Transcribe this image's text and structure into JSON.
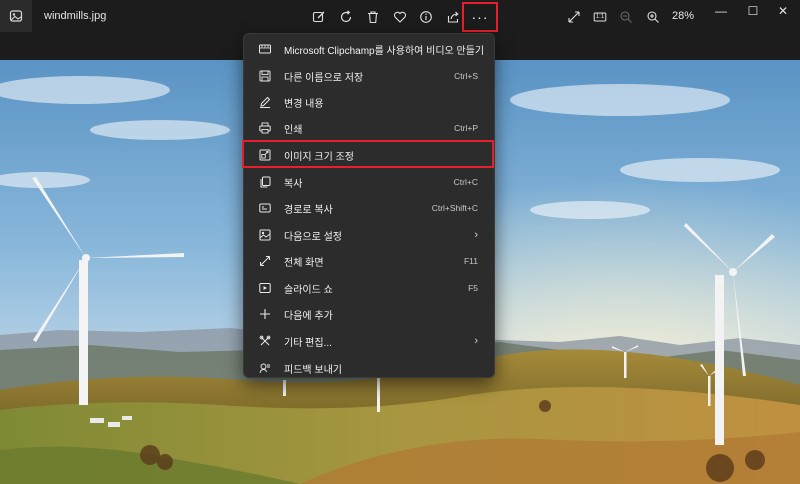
{
  "titlebar": {
    "filename": "windmills.jpg",
    "zoom": "28%",
    "more_label": "···",
    "actual_size_label": "1:1",
    "toolbar_icons": [
      "edit-icon",
      "rotate-icon",
      "delete-icon",
      "favorite-icon",
      "info-icon",
      "share-icon",
      "more-icon"
    ],
    "right_icons": [
      "fullscreen-icon",
      "actual-size-icon",
      "zoom-out-icon",
      "zoom-in-icon"
    ],
    "window_controls": {
      "minimize": "—",
      "maximize": "☐",
      "close": "✕"
    }
  },
  "menu": {
    "items": [
      {
        "label": "Microsoft Clipchamp를 사용하여 비디오 만들기",
        "shortcut": "",
        "icon": "clipchamp-icon",
        "submenu": false
      },
      {
        "label": "다른 이름으로 저장",
        "shortcut": "Ctrl+S",
        "icon": "save-icon",
        "submenu": false
      },
      {
        "label": "변경 내용",
        "shortcut": "",
        "icon": "pen-icon",
        "submenu": false
      },
      {
        "label": "인쇄",
        "shortcut": "Ctrl+P",
        "icon": "print-icon",
        "submenu": false
      },
      {
        "label": "이미지 크기 조정",
        "shortcut": "",
        "icon": "resize-icon",
        "submenu": false
      },
      {
        "label": "복사",
        "shortcut": "Ctrl+C",
        "icon": "copy-icon",
        "submenu": false
      },
      {
        "label": "경로로 복사",
        "shortcut": "Ctrl+Shift+C",
        "icon": "copy-path-icon",
        "submenu": false
      },
      {
        "label": "다음으로 설정",
        "shortcut": "",
        "icon": "set-as-icon",
        "submenu": true
      },
      {
        "label": "전체 화면",
        "shortcut": "F11",
        "icon": "fullscreen-icon",
        "submenu": false
      },
      {
        "label": "슬라이드 쇼",
        "shortcut": "F5",
        "icon": "slideshow-icon",
        "submenu": false
      },
      {
        "label": "다음에 추가",
        "shortcut": "",
        "icon": "add-icon",
        "submenu": false
      },
      {
        "label": "기타 편집...",
        "shortcut": "",
        "icon": "more-edits-icon",
        "submenu": true
      },
      {
        "label": "피드백 보내기",
        "shortcut": "",
        "icon": "feedback-icon",
        "submenu": false
      }
    ],
    "chevron": "›"
  },
  "colors": {
    "highlight_border": "#e5202b",
    "menu_bg": "#2c2c2c",
    "titlebar_bg": "#1c1c1c"
  }
}
